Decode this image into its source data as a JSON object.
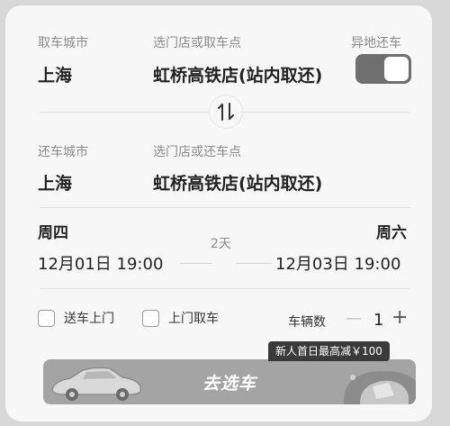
{
  "pickup": {
    "city_label": "取车城市",
    "city_value": "上海",
    "store_label": "选门店或取车点",
    "store_value": "虹桥高铁店(站内取还)"
  },
  "different_return": {
    "label": "异地还车",
    "enabled": true
  },
  "return": {
    "city_label": "还车城市",
    "city_value": "上海",
    "store_label": "选门店或还车点",
    "store_value": "虹桥高铁店(站内取还)"
  },
  "schedule": {
    "pickup_weekday": "周四",
    "pickup_datetime": "12月01日 19:00",
    "duration": "2天",
    "return_weekday": "周六",
    "return_datetime": "12月03日 19:00"
  },
  "options": {
    "delivery_label": "送车上门",
    "pickup_service_label": "上门取车",
    "car_count_label": "车辆数",
    "car_count": "1",
    "minus": "—",
    "plus": "+"
  },
  "promo": {
    "badge": "新人首日最高减￥100"
  },
  "action": {
    "button_label": "去选车"
  },
  "icons": {
    "swap": "swap-vertical-icon",
    "car": "car-illustration-icon",
    "decoration": "promo-decoration-icon"
  }
}
